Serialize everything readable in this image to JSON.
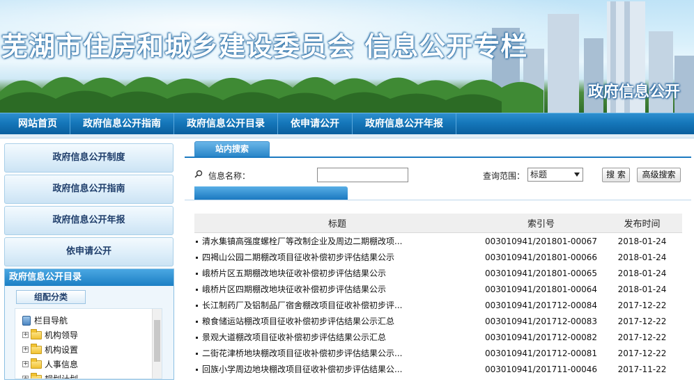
{
  "banner": {
    "title": "芜湖市住房和城乡建设委员会 信息公开专栏",
    "subtitle": "政府信息公开"
  },
  "nav": {
    "items": [
      "网站首页",
      "政府信息公开指南",
      "政府信息公开目录",
      "依申请公开",
      "政府信息公开年报"
    ]
  },
  "sidebar": {
    "buttons": [
      "政府信息公开制度",
      "政府信息公开指南",
      "政府信息公开年报",
      "依申请公开"
    ],
    "catalog_title": "政府信息公开目录",
    "group_tab": "组配分类",
    "tree": {
      "root": "栏目导航",
      "children": [
        "机构领导",
        "机构设置",
        "人事信息",
        "规划计划"
      ]
    }
  },
  "search": {
    "tab_label": "站内搜索",
    "name_label": "信息名称：",
    "name_value": "",
    "scope_label": "查询范围：",
    "scope_selected": "标题",
    "search_button": "搜 索",
    "advanced_button": "高级搜索"
  },
  "table": {
    "headers": [
      "标题",
      "索引号",
      "发布时间"
    ],
    "rows": [
      {
        "title": "清水集镇高强度螺栓厂等改制企业及周边二期棚改项...",
        "index": "003010941/201801-00067",
        "date": "2018-01-24"
      },
      {
        "title": "四褐山公园二期棚改项目征收补偿初步评估结果公示",
        "index": "003010941/201801-00066",
        "date": "2018-01-24"
      },
      {
        "title": "峨桥片区五期棚改地块征收补偿初步评估结果公示",
        "index": "003010941/201801-00065",
        "date": "2018-01-24"
      },
      {
        "title": "峨桥片区四期棚改地块征收补偿初步评估结果公示",
        "index": "003010941/201801-00064",
        "date": "2018-01-24"
      },
      {
        "title": "长江制药厂及铝制品厂宿舍棚改项目征收补偿初步评...",
        "index": "003010941/201712-00084",
        "date": "2017-12-22"
      },
      {
        "title": "粮食储运站棚改项目征收补偿初步评估结果公示汇总",
        "index": "003010941/201712-00083",
        "date": "2017-12-22"
      },
      {
        "title": "景观大道棚改项目征收补偿初步评估结果公示汇总",
        "index": "003010941/201712-00082",
        "date": "2017-12-22"
      },
      {
        "title": "二街花津桥地块棚改项目征收补偿初步评估结果公示...",
        "index": "003010941/201712-00081",
        "date": "2017-12-22"
      },
      {
        "title": "回族小学周边地块棚改项目征收补偿初步评估结果公...",
        "index": "003010941/201711-00046",
        "date": "2017-11-22"
      }
    ]
  },
  "colors": {
    "nav_blue": "#1577ba",
    "accent_blue": "#1b79c0",
    "sidebar_text": "#1f3e6b"
  }
}
